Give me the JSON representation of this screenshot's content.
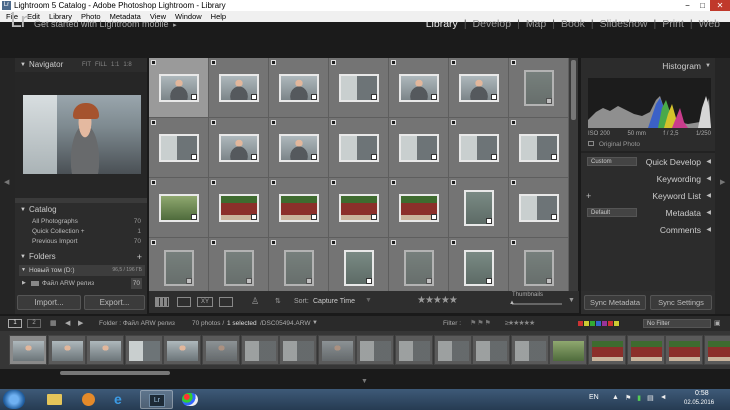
{
  "window": {
    "title": "Lightroom 5 Catalog - Adobe Photoshop Lightroom - Library",
    "min": "−",
    "max": "□",
    "close": "✕"
  },
  "menu": [
    "File",
    "Edit",
    "Library",
    "Photo",
    "Metadata",
    "View",
    "Window",
    "Help"
  ],
  "header": {
    "logo": "Lr",
    "identity": "Get started with Lightroom mobile",
    "identity_arrow": "▸"
  },
  "modules": [
    {
      "label": "Library",
      "active": true
    },
    {
      "label": "Develop"
    },
    {
      "label": "Map"
    },
    {
      "label": "Book"
    },
    {
      "label": "Slideshow"
    },
    {
      "label": "Print"
    },
    {
      "label": "Web"
    }
  ],
  "navigator": {
    "title": "Navigator",
    "options": [
      "FIT",
      "FILL",
      "1:1",
      "1:8"
    ]
  },
  "catalog": {
    "title": "Catalog",
    "rows": [
      {
        "label": "All Photographs",
        "count": "70"
      },
      {
        "label": "Quick Collection +",
        "count": "1"
      },
      {
        "label": "Previous Import",
        "count": "70"
      }
    ]
  },
  "folders": {
    "title": "Folders",
    "add": "+",
    "drive": {
      "label": "Новый том (D:)",
      "info": "96,5 / 196 ГБ"
    },
    "folder": {
      "label": "Файл ARW релиз",
      "count": "70"
    }
  },
  "buttons": {
    "import": "Import...",
    "export": "Export...",
    "sync_metadata": "Sync Metadata",
    "sync_settings": "Sync Settings"
  },
  "toolbar": {
    "sort_label": "Sort:",
    "sort_value": "Capture Time",
    "stars": "★★★★★",
    "thumbnails_label": "Thumbnails"
  },
  "right_panel": {
    "histogram": "Histogram",
    "iso": "ISO 200",
    "focal": "50 mm",
    "aperture": "f / 2,5",
    "shutter": "1/250",
    "original_photo": "Original Photo",
    "quick_develop": "Quick Develop",
    "quick_develop_preset": "Custom",
    "keywording": "Keywording",
    "keyword_list": "Keyword List",
    "metadata": "Metadata",
    "metadata_preset": "Default",
    "comments": "Comments"
  },
  "filmstrip_bar": {
    "view1": "1",
    "view2": "2",
    "folder_label": "Folder : Файл ARW релиз",
    "photo_count": "70 photos /",
    "selected": "1 selected",
    "path": "/DSC05494.ARW",
    "filter_label": "Filter :",
    "filter_value": "No Filter"
  },
  "taskbar": {
    "lang": "EN",
    "time": "0:58",
    "date": "02.05.2016"
  },
  "colors": {
    "accent": "#2e2e2e",
    "panel": "#2c2c2c",
    "grid": "#6f6f6f"
  }
}
